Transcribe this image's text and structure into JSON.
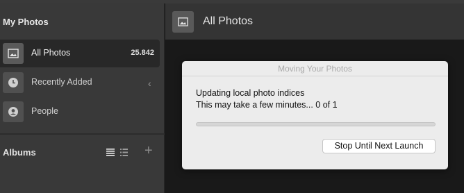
{
  "sidebar": {
    "heading": "My Photos",
    "items": [
      {
        "label": "All Photos",
        "count": "25.842",
        "icon": "photo-icon",
        "selected": true
      },
      {
        "label": "Recently Added",
        "icon": "clock-icon",
        "chevron": "‹"
      },
      {
        "label": "People",
        "icon": "person-icon"
      }
    ],
    "albums": {
      "heading": "Albums",
      "add": "+"
    }
  },
  "header": {
    "title": "All Photos",
    "icon": "photo-icon"
  },
  "dialog": {
    "title": "Moving Your Photos",
    "line1": "Updating local photo indices",
    "line2": "This may take a few minutes... 0 of 1",
    "progress": 0,
    "button": "Stop Until Next Launch"
  },
  "colors": {
    "sidebar": "#393939",
    "selected": "#282828",
    "content": "#191919",
    "dialog": "#ececec"
  }
}
